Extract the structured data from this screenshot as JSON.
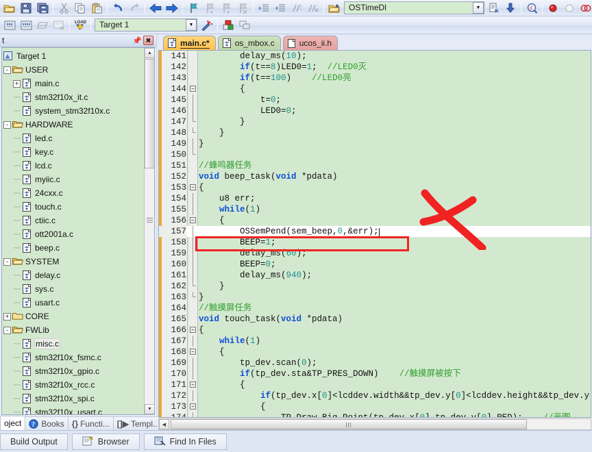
{
  "toolbar1": {
    "buttons": [
      {
        "name": "open-file-icon",
        "glyph": "folder-open"
      },
      {
        "name": "save-icon",
        "glyph": "floppy"
      },
      {
        "name": "save-all-icon",
        "glyph": "floppy-multi"
      },
      {
        "name": "cut-icon",
        "glyph": "scissors"
      },
      {
        "name": "copy-icon",
        "glyph": "copy"
      },
      {
        "name": "paste-icon",
        "glyph": "paste"
      },
      {
        "name": "undo-icon",
        "glyph": "undo"
      },
      {
        "name": "redo-icon",
        "glyph": "redo"
      },
      {
        "name": "navigate-back-icon",
        "glyph": "arrow-left"
      },
      {
        "name": "navigate-forward-icon",
        "glyph": "arrow-right"
      },
      {
        "name": "bookmark-toggle-icon",
        "glyph": "flag"
      },
      {
        "name": "bookmark-prev-icon",
        "glyph": "flag-prev"
      },
      {
        "name": "bookmark-next-icon",
        "glyph": "flag-next"
      },
      {
        "name": "bookmark-clear-icon",
        "glyph": "flag-clear"
      },
      {
        "name": "indent-icon",
        "glyph": "indent"
      },
      {
        "name": "outdent-icon",
        "glyph": "outdent"
      },
      {
        "name": "comment-icon",
        "glyph": "comment"
      },
      {
        "name": "uncomment-icon",
        "glyph": "uncomment"
      },
      {
        "name": "open-workspace-icon",
        "glyph": "folder-hand"
      }
    ]
  },
  "toolbar1_right": {
    "function_combo_value": "OSTimeDl",
    "buttons": [
      {
        "name": "insert-file-icon",
        "glyph": "doc-arrow"
      },
      {
        "name": "download-icon",
        "glyph": "down-arrow"
      },
      {
        "name": "find-in-files-icon",
        "glyph": "magnify-d"
      },
      {
        "name": "breakpoint-insert-icon",
        "glyph": "red-dot"
      },
      {
        "name": "breakpoint-kill-icon",
        "glyph": "grey-dot"
      },
      {
        "name": "breakpoint-disable-icon",
        "glyph": "hollow-dots"
      },
      {
        "name": "breakpoint-disable-all-icon",
        "glyph": "red-dot-x"
      },
      {
        "name": "project-window-icon",
        "glyph": "panel"
      }
    ]
  },
  "toolbar2": {
    "target_combo_value": "Target 1",
    "buttons": [
      {
        "name": "translate-icon",
        "glyph": "build-1"
      },
      {
        "name": "build-icon",
        "glyph": "build-2"
      },
      {
        "name": "rebuild-icon",
        "glyph": "build-3"
      },
      {
        "name": "batch-build-icon",
        "glyph": "build-4"
      },
      {
        "name": "download-to-flash-icon",
        "glyph": "load"
      },
      {
        "name": "target-options-icon",
        "glyph": "magic-wand"
      },
      {
        "name": "manage-components-icon",
        "glyph": "components"
      },
      {
        "name": "manage-multi-project-icon",
        "glyph": "multi-project"
      }
    ]
  },
  "project_pane": {
    "title": "t",
    "pin_tooltip": "pin",
    "close_label": "✖",
    "tree": [
      {
        "depth": 0,
        "label": "Target 1",
        "icon": "target-icon",
        "expander": "",
        "lead": false
      },
      {
        "depth": 1,
        "label": "USER",
        "icon": "folder-open-small",
        "expander": "-",
        "lead": true
      },
      {
        "depth": 2,
        "label": "main.c",
        "icon": "c-file",
        "expander": "+",
        "lead": true
      },
      {
        "depth": 2,
        "label": "stm32f10x_it.c",
        "icon": "c-file",
        "expander": "",
        "lead": true
      },
      {
        "depth": 2,
        "label": "system_stm32f10x.c",
        "icon": "c-file",
        "expander": "",
        "lead": true
      },
      {
        "depth": 1,
        "label": "HARDWARE",
        "icon": "folder-open-small",
        "expander": "-",
        "lead": true
      },
      {
        "depth": 2,
        "label": "led.c",
        "icon": "c-file",
        "expander": "",
        "lead": true
      },
      {
        "depth": 2,
        "label": "key.c",
        "icon": "c-file",
        "expander": "",
        "lead": true
      },
      {
        "depth": 2,
        "label": "lcd.c",
        "icon": "c-file",
        "expander": "",
        "lead": true
      },
      {
        "depth": 2,
        "label": "myiic.c",
        "icon": "c-file",
        "expander": "",
        "lead": true
      },
      {
        "depth": 2,
        "label": "24cxx.c",
        "icon": "c-file",
        "expander": "",
        "lead": true
      },
      {
        "depth": 2,
        "label": "touch.c",
        "icon": "c-file",
        "expander": "",
        "lead": true
      },
      {
        "depth": 2,
        "label": "ctiic.c",
        "icon": "c-file",
        "expander": "",
        "lead": true
      },
      {
        "depth": 2,
        "label": "ott2001a.c",
        "icon": "c-file",
        "expander": "",
        "lead": true
      },
      {
        "depth": 2,
        "label": "beep.c",
        "icon": "c-file",
        "expander": "",
        "lead": true
      },
      {
        "depth": 1,
        "label": "SYSTEM",
        "icon": "folder-open-small",
        "expander": "-",
        "lead": true
      },
      {
        "depth": 2,
        "label": "delay.c",
        "icon": "c-file",
        "expander": "",
        "lead": true
      },
      {
        "depth": 2,
        "label": "sys.c",
        "icon": "c-file",
        "expander": "",
        "lead": true
      },
      {
        "depth": 2,
        "label": "usart.c",
        "icon": "c-file",
        "expander": "",
        "lead": true
      },
      {
        "depth": 1,
        "label": "CORE",
        "icon": "folder-closed-small",
        "expander": "+",
        "lead": true
      },
      {
        "depth": 1,
        "label": "FWLib",
        "icon": "folder-open-small",
        "expander": "-",
        "lead": true
      },
      {
        "depth": 2,
        "label": "misc.c",
        "icon": "c-file",
        "expander": "",
        "lead": true,
        "selected": true
      },
      {
        "depth": 2,
        "label": "stm32f10x_fsmc.c",
        "icon": "c-file",
        "expander": "",
        "lead": true
      },
      {
        "depth": 2,
        "label": "stm32f10x_gpio.c",
        "icon": "c-file",
        "expander": "",
        "lead": true
      },
      {
        "depth": 2,
        "label": "stm32f10x_rcc.c",
        "icon": "c-file",
        "expander": "",
        "lead": true
      },
      {
        "depth": 2,
        "label": "stm32f10x_spi.c",
        "icon": "c-file",
        "expander": "",
        "lead": true
      },
      {
        "depth": 2,
        "label": "stm32f10x_usart.c",
        "icon": "c-file",
        "expander": "",
        "lead": true
      }
    ],
    "tabs": [
      {
        "label": "oject",
        "name": "tab-project",
        "active": true,
        "icon": ""
      },
      {
        "label": "Books",
        "name": "tab-books",
        "active": false,
        "icon": "books-icon"
      },
      {
        "label": "Functi...",
        "name": "tab-functions",
        "active": false,
        "icon": "{}"
      },
      {
        "label": "Templ...",
        "name": "tab-templates",
        "active": false,
        "icon": "[]"
      }
    ]
  },
  "editor": {
    "tabs": [
      {
        "label": "main.c*",
        "name": "editor-tab-main-c",
        "active": true,
        "style": "main"
      },
      {
        "label": "os_mbox.c",
        "name": "editor-tab-os-mbox-c",
        "active": false,
        "style": "green"
      },
      {
        "label": "ucos_ii.h",
        "name": "editor-tab-ucos-ii-h",
        "active": false,
        "style": "pink"
      }
    ],
    "first_line": 141,
    "current_line": 157,
    "code_lines": [
      {
        "n": 141,
        "indent": 8,
        "tokens": [
          {
            "t": "delay_ms",
            "c": "plain"
          },
          {
            "t": "(",
            "c": "plain"
          },
          {
            "t": "10",
            "c": "num-lit"
          },
          {
            "t": ");",
            "c": "plain"
          }
        ],
        "fold": ""
      },
      {
        "n": 142,
        "indent": 8,
        "tokens": [
          {
            "t": "if",
            "c": "kw"
          },
          {
            "t": "(t==",
            "c": "plain"
          },
          {
            "t": "8",
            "c": "num-lit"
          },
          {
            "t": ")LED0=",
            "c": "plain"
          },
          {
            "t": "1",
            "c": "num-lit"
          },
          {
            "t": ";  ",
            "c": "plain"
          },
          {
            "t": "//LED0灭",
            "c": "cmt"
          }
        ],
        "fold": ""
      },
      {
        "n": 143,
        "indent": 8,
        "tokens": [
          {
            "t": "if",
            "c": "kw"
          },
          {
            "t": "(t==",
            "c": "plain"
          },
          {
            "t": "100",
            "c": "num-lit"
          },
          {
            "t": ")    ",
            "c": "plain"
          },
          {
            "t": "//LED0亮",
            "c": "cmt"
          }
        ],
        "fold": ""
      },
      {
        "n": 144,
        "indent": 8,
        "tokens": [
          {
            "t": "{",
            "c": "plain"
          }
        ],
        "fold": "box"
      },
      {
        "n": 145,
        "indent": 12,
        "tokens": [
          {
            "t": "t=",
            "c": "plain"
          },
          {
            "t": "0",
            "c": "num-lit"
          },
          {
            "t": ";",
            "c": "plain"
          }
        ],
        "fold": "line"
      },
      {
        "n": 146,
        "indent": 12,
        "tokens": [
          {
            "t": "LED0=",
            "c": "plain"
          },
          {
            "t": "0",
            "c": "num-lit"
          },
          {
            "t": ";",
            "c": "plain"
          }
        ],
        "fold": "line"
      },
      {
        "n": 147,
        "indent": 8,
        "tokens": [
          {
            "t": "}",
            "c": "plain"
          }
        ],
        "fold": "end"
      },
      {
        "n": 148,
        "indent": 4,
        "tokens": [
          {
            "t": "}",
            "c": "plain"
          }
        ],
        "fold": "end"
      },
      {
        "n": 149,
        "indent": 0,
        "tokens": [
          {
            "t": "}",
            "c": "plain"
          }
        ],
        "fold": "line"
      },
      {
        "n": 150,
        "indent": 0,
        "tokens": [],
        "fold": "end"
      },
      {
        "n": 151,
        "indent": 0,
        "tokens": [
          {
            "t": "//蜂鸣器任务",
            "c": "cmt"
          }
        ],
        "fold": ""
      },
      {
        "n": 152,
        "indent": 0,
        "tokens": [
          {
            "t": "void",
            "c": "kw"
          },
          {
            "t": " beep_task(",
            "c": "plain"
          },
          {
            "t": "void",
            "c": "kw"
          },
          {
            "t": " *pdata)",
            "c": "plain"
          }
        ],
        "fold": ""
      },
      {
        "n": 153,
        "indent": 0,
        "tokens": [
          {
            "t": "{",
            "c": "plain"
          }
        ],
        "fold": "box"
      },
      {
        "n": 154,
        "indent": 4,
        "tokens": [
          {
            "t": "u8 err;",
            "c": "plain"
          }
        ],
        "fold": "line"
      },
      {
        "n": 155,
        "indent": 4,
        "tokens": [
          {
            "t": "while",
            "c": "kw"
          },
          {
            "t": "(",
            "c": "plain"
          },
          {
            "t": "1",
            "c": "num-lit"
          },
          {
            "t": ")",
            "c": "plain"
          }
        ],
        "fold": "line"
      },
      {
        "n": 156,
        "indent": 4,
        "tokens": [
          {
            "t": "{",
            "c": "plain"
          }
        ],
        "fold": "box"
      },
      {
        "n": 157,
        "indent": 8,
        "tokens": [
          {
            "t": "OSSemPend(sem_beep,",
            "c": "plain"
          },
          {
            "t": "0",
            "c": "num-lit"
          },
          {
            "t": ",&err);",
            "c": "plain"
          }
        ],
        "fold": "line",
        "current": true
      },
      {
        "n": 158,
        "indent": 8,
        "tokens": [
          {
            "t": "BEEP=",
            "c": "plain"
          },
          {
            "t": "1",
            "c": "num-lit"
          },
          {
            "t": ";",
            "c": "plain"
          }
        ],
        "fold": "line"
      },
      {
        "n": 159,
        "indent": 8,
        "tokens": [
          {
            "t": "delay_ms",
            "c": "plain"
          },
          {
            "t": "(",
            "c": "plain"
          },
          {
            "t": "60",
            "c": "num-lit"
          },
          {
            "t": ");",
            "c": "plain"
          }
        ],
        "fold": "line"
      },
      {
        "n": 160,
        "indent": 8,
        "tokens": [
          {
            "t": "BEEP=",
            "c": "plain"
          },
          {
            "t": "0",
            "c": "num-lit"
          },
          {
            "t": ";",
            "c": "plain"
          }
        ],
        "fold": "line"
      },
      {
        "n": 161,
        "indent": 8,
        "tokens": [
          {
            "t": "delay_ms",
            "c": "plain"
          },
          {
            "t": "(",
            "c": "plain"
          },
          {
            "t": "940",
            "c": "num-lit"
          },
          {
            "t": ");",
            "c": "plain"
          }
        ],
        "fold": "line"
      },
      {
        "n": 162,
        "indent": 4,
        "tokens": [
          {
            "t": "}",
            "c": "plain"
          }
        ],
        "fold": "end"
      },
      {
        "n": 163,
        "indent": 0,
        "tokens": [
          {
            "t": "}",
            "c": "plain"
          }
        ],
        "fold": "end"
      },
      {
        "n": 164,
        "indent": 0,
        "tokens": [
          {
            "t": "//触摸屏任务",
            "c": "cmt"
          }
        ],
        "fold": ""
      },
      {
        "n": 165,
        "indent": 0,
        "tokens": [
          {
            "t": "void",
            "c": "kw"
          },
          {
            "t": " touch_task(",
            "c": "plain"
          },
          {
            "t": "void",
            "c": "kw"
          },
          {
            "t": " *pdata)",
            "c": "plain"
          }
        ],
        "fold": ""
      },
      {
        "n": 166,
        "indent": 0,
        "tokens": [
          {
            "t": "{",
            "c": "plain"
          }
        ],
        "fold": "box"
      },
      {
        "n": 167,
        "indent": 4,
        "tokens": [
          {
            "t": "while",
            "c": "kw"
          },
          {
            "t": "(",
            "c": "plain"
          },
          {
            "t": "1",
            "c": "num-lit"
          },
          {
            "t": ")",
            "c": "plain"
          }
        ],
        "fold": "line"
      },
      {
        "n": 168,
        "indent": 4,
        "tokens": [
          {
            "t": "{",
            "c": "plain"
          }
        ],
        "fold": "box"
      },
      {
        "n": 169,
        "indent": 8,
        "tokens": [
          {
            "t": "tp_dev.scan(",
            "c": "plain"
          },
          {
            "t": "0",
            "c": "num-lit"
          },
          {
            "t": ");",
            "c": "plain"
          }
        ],
        "fold": "line"
      },
      {
        "n": 170,
        "indent": 8,
        "tokens": [
          {
            "t": "if",
            "c": "kw"
          },
          {
            "t": "(tp_dev.sta&TP_PRES_DOWN)    ",
            "c": "plain"
          },
          {
            "t": "//触摸屏被按下",
            "c": "cmt"
          }
        ],
        "fold": "line"
      },
      {
        "n": 171,
        "indent": 8,
        "tokens": [
          {
            "t": "{",
            "c": "plain"
          }
        ],
        "fold": "box"
      },
      {
        "n": 172,
        "indent": 12,
        "tokens": [
          {
            "t": "if",
            "c": "kw"
          },
          {
            "t": "(tp_dev.x[",
            "c": "plain"
          },
          {
            "t": "0",
            "c": "num-lit"
          },
          {
            "t": "]<lcddev.width&&tp_dev.y[",
            "c": "plain"
          },
          {
            "t": "0",
            "c": "num-lit"
          },
          {
            "t": "]<lcddev.height&&tp_dev.y",
            "c": "plain"
          }
        ],
        "fold": "line"
      },
      {
        "n": 173,
        "indent": 12,
        "tokens": [
          {
            "t": "{",
            "c": "plain"
          }
        ],
        "fold": "box"
      },
      {
        "n": 174,
        "indent": 16,
        "tokens": [
          {
            "t": "TP_Draw_Big_Point(tp_dev.x[",
            "c": "plain"
          },
          {
            "t": "0",
            "c": "num-lit"
          },
          {
            "t": "],tp_dev.y[",
            "c": "plain"
          },
          {
            "t": "0",
            "c": "num-lit"
          },
          {
            "t": "],RED);    ",
            "c": "plain"
          },
          {
            "t": "//画图",
            "c": "cmt"
          }
        ],
        "fold": "line"
      }
    ]
  },
  "annotations": {
    "red_box_target_line": 157,
    "red_x_color": "#f02222",
    "red_box_color": "#f02222"
  },
  "bottom_tabs": [
    {
      "label": "Build Output",
      "name": "tab-build-output",
      "icon": ""
    },
    {
      "label": "Browser",
      "name": "tab-browser",
      "icon": "browser-icon"
    },
    {
      "label": "Find In Files",
      "name": "tab-find-in-files",
      "icon": "find-icon"
    }
  ],
  "colors": {
    "editor_bg": "#d3e9cf",
    "current_line_bg": "#ffffff",
    "keyword": "#0f4fd8",
    "comment": "#2f9e2f",
    "number": "#1b8f8f",
    "tab_active": "#ffc34d"
  }
}
